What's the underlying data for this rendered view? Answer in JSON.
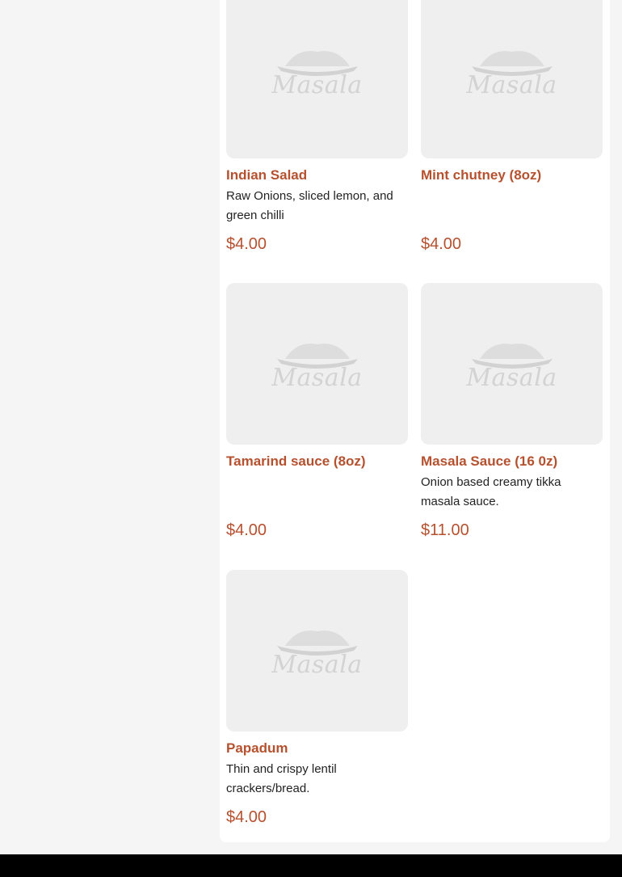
{
  "menu": {
    "items": [
      {
        "name": "Indian Salad",
        "description": "Raw Onions, sliced lemon, and green chilli",
        "price": "$4.00",
        "image_logo_text": "Masala"
      },
      {
        "name": "Mint chutney (8oz)",
        "description": "",
        "price": "$4.00",
        "image_logo_text": "Masala"
      },
      {
        "name": "Tamarind sauce (8oz)",
        "description": "",
        "price": "$4.00",
        "image_logo_text": "Masala"
      },
      {
        "name": "Masala Sauce (16 0z)",
        "description": "Onion based creamy tikka masala sauce.",
        "price": "$11.00",
        "image_logo_text": "Masala"
      },
      {
        "name": "Papadum",
        "description": "Thin and crispy lentil crackers/bread.",
        "price": "$4.00",
        "image_logo_text": "Masala"
      }
    ]
  },
  "colors": {
    "accent": "#b5512f",
    "placeholder_bg": "#efefef",
    "footer": "#000000"
  },
  "icons": {
    "placeholder": "masala-logo-icon"
  }
}
